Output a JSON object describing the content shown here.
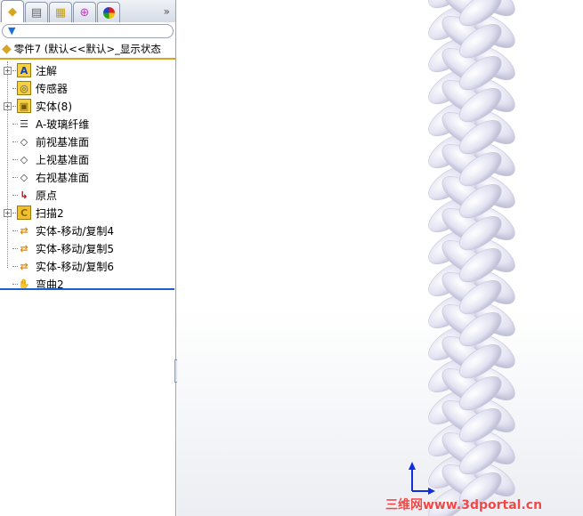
{
  "tabs": [
    {
      "name": "feature-manager",
      "icon": "part-icon"
    },
    {
      "name": "property-manager",
      "icon": "property-icon"
    },
    {
      "name": "configuration-manager",
      "icon": "config-icon"
    },
    {
      "name": "dimxpert",
      "icon": "crosshair-icon"
    },
    {
      "name": "display-manager",
      "icon": "appearance-icon"
    }
  ],
  "more": "»",
  "filter_icon": "filter-icon",
  "root": "零件7  (默认<<默认>_显示状态",
  "items": [
    {
      "label": "注解",
      "expand": "+"
    },
    {
      "label": "传感器"
    },
    {
      "label": "实体(8)",
      "expand": "+"
    },
    {
      "label": "A-玻璃纤维"
    },
    {
      "label": "前视基准面"
    },
    {
      "label": "上视基准面"
    },
    {
      "label": "右视基准面"
    },
    {
      "label": "原点"
    },
    {
      "label": "扫描2",
      "expand": "+"
    },
    {
      "label": "实体-移动/复制4"
    },
    {
      "label": "实体-移动/复制5"
    },
    {
      "label": "实体-移动/复制6"
    },
    {
      "label": "弯曲2"
    }
  ],
  "watermark": "三维网www.3dportal.cn",
  "colors": {
    "accent": "#d8a520",
    "selection": "#1b5fd0",
    "model": "#dcdcef"
  }
}
